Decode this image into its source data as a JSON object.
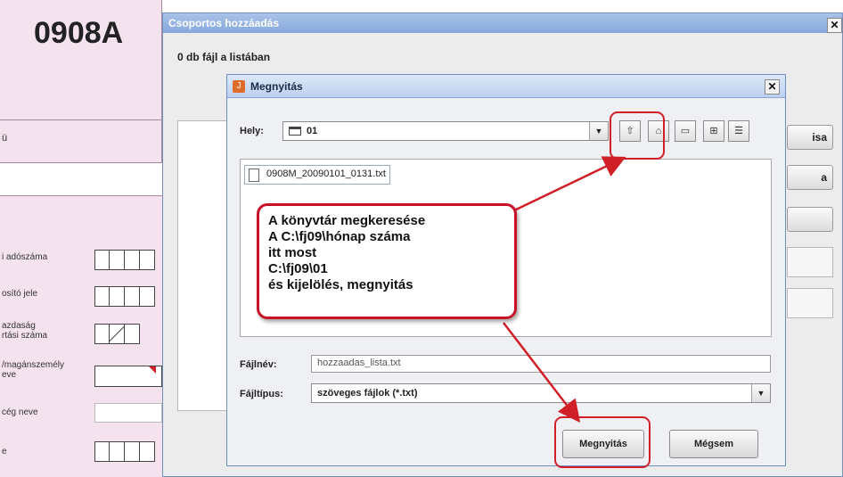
{
  "form": {
    "code": "0908A",
    "side_mark": "ü",
    "rows": [
      {
        "label": "i adószáma"
      },
      {
        "label": "osító jele"
      },
      {
        "label": "azdaság\nrtási száma"
      },
      {
        "label": "/magánszemély\neve"
      },
      {
        "label": "cég neve"
      },
      {
        "label": "e"
      }
    ]
  },
  "dialog": {
    "title": "Csoportos hozzáadás",
    "files_count": "0 db fájl a listában",
    "side_buttons": [
      "isa",
      "a"
    ]
  },
  "open_dialog": {
    "title": "Megnyitás",
    "location_label": "Hely:",
    "location_value": "01",
    "file_item": "0908M_20090101_0131.txt",
    "filename_label": "Fájlnév:",
    "filename_value": "hozzaadas_lista.txt",
    "filetype_label": "Fájltípus:",
    "filetype_value": "szöveges fájlok (*.txt)",
    "open_button": "Megnyitás",
    "cancel_button": "Mégsem"
  },
  "callout": {
    "lines": [
      "A könyvtár megkeresése",
      "A C:\\fj09\\hónap száma",
      "itt most",
      "C:\\fj09\\01",
      "és kijelölés, megnyitás"
    ]
  },
  "colors": {
    "annotation": "#d01f26",
    "form_bg": "#f4e2ee"
  }
}
